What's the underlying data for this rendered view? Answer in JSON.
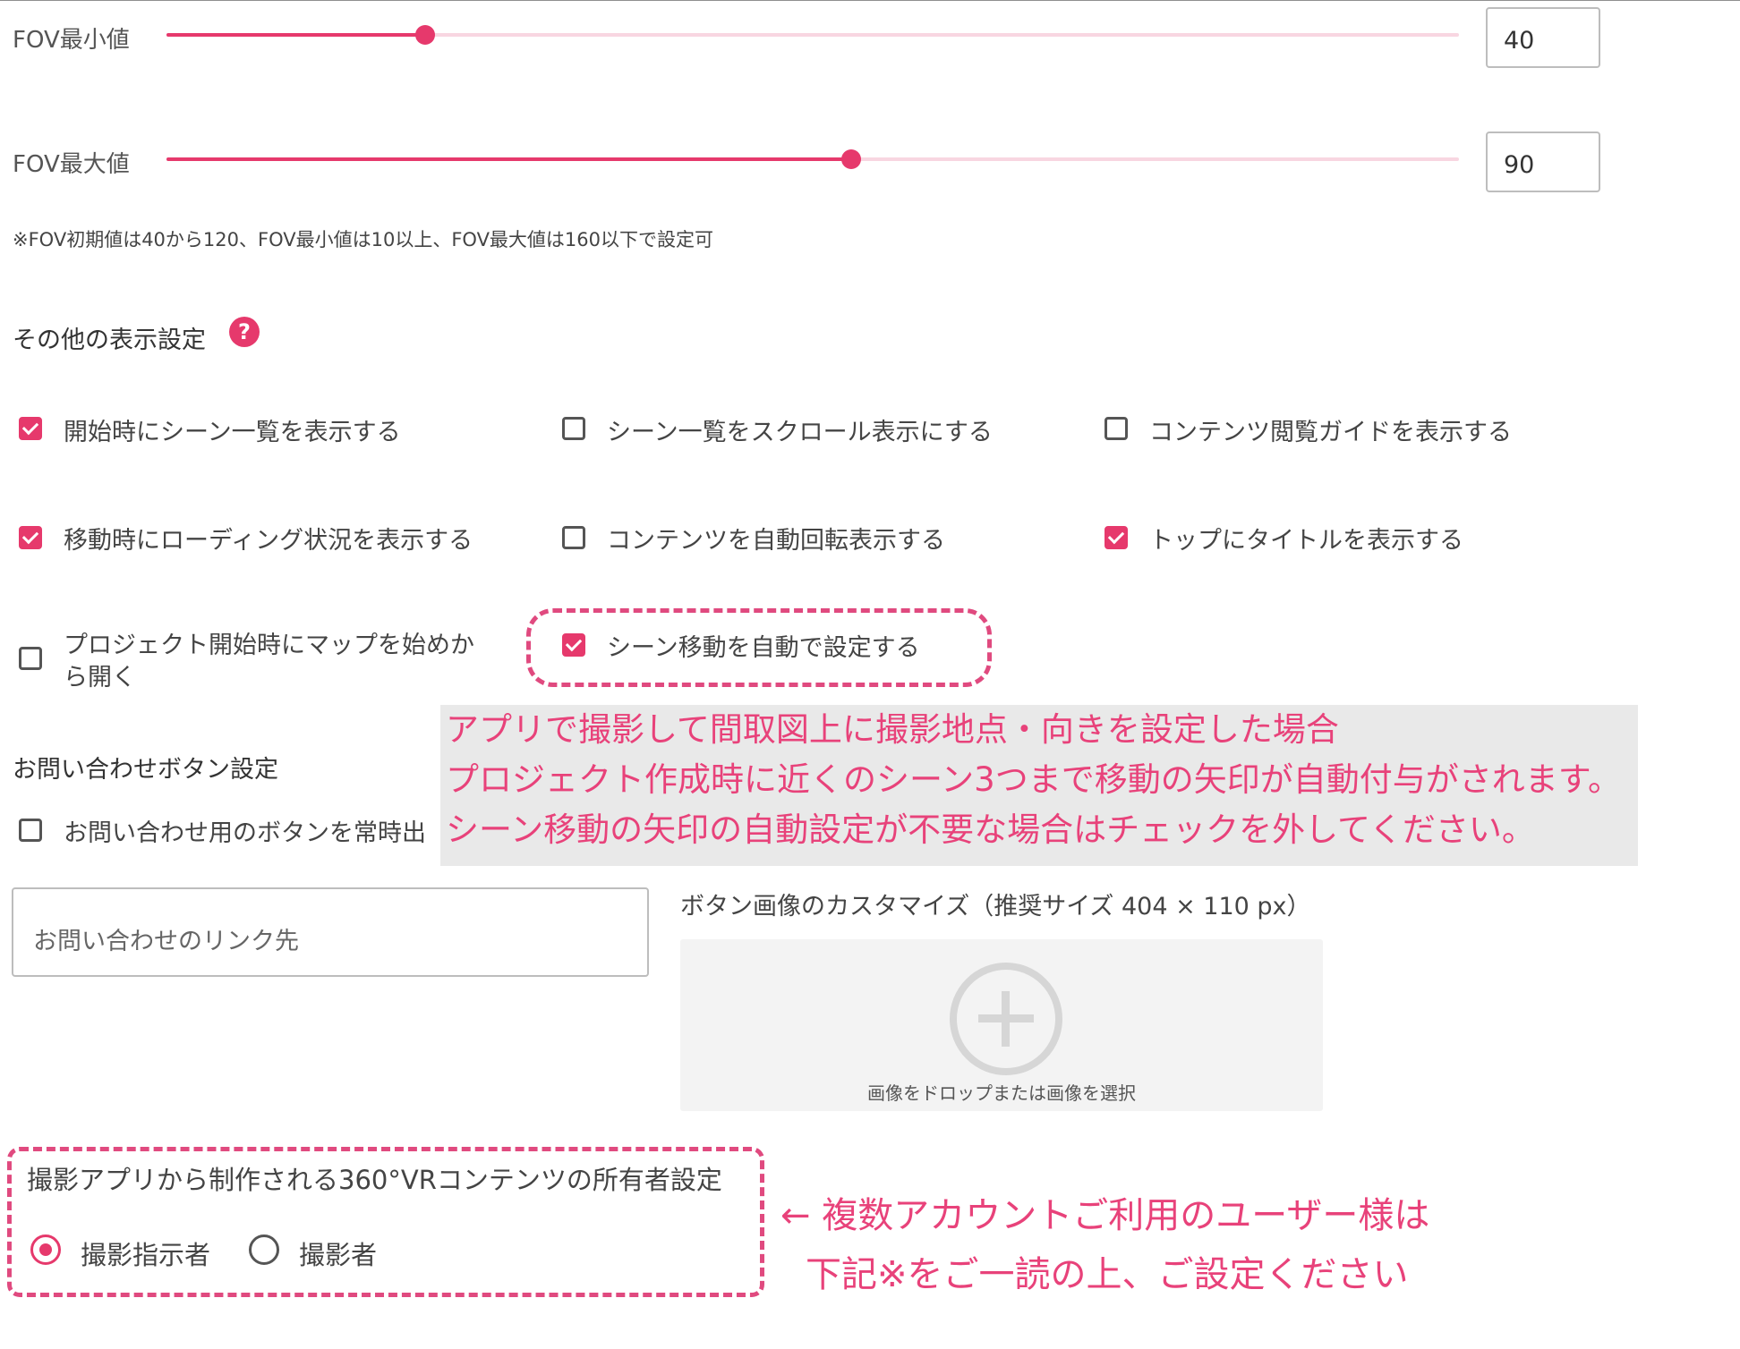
{
  "fov": {
    "min": {
      "label": "FOV最小値",
      "value": "40",
      "fraction": 0.2
    },
    "max": {
      "label": "FOV最大値",
      "value": "90",
      "fraction": 0.53
    },
    "note": "※FOV初期値は40から120、FOV最小値は10以上、FOV最大値は160以下で設定可"
  },
  "display_settings": {
    "heading": "その他の表示設定",
    "help_icon": "?",
    "options": [
      {
        "label": "開始時にシーン一覧を表示する",
        "checked": true
      },
      {
        "label": "シーン一覧をスクロール表示にする",
        "checked": false
      },
      {
        "label": "コンテンツ閲覧ガイドを表示する",
        "checked": false
      },
      {
        "label": "移動時にローディング状況を表示する",
        "checked": true
      },
      {
        "label": "コンテンツを自動回転表示する",
        "checked": false
      },
      {
        "label": "トップにタイトルを表示する",
        "checked": true
      },
      {
        "label_line1": "プロジェクト開始時にマップを始めか",
        "label_line2": "ら開く",
        "checked": false
      },
      {
        "label": "シーン移動を自動で設定する",
        "checked": true
      }
    ]
  },
  "callout": {
    "lines": [
      "アプリで撮影して間取図上に撮影地点・向きを設定した場合",
      "プロジェクト作成時に近くのシーン3つまで移動の矢印が自動付与がされます。",
      "シーン移動の矢印の自動設定が不要な場合はチェックを外してください。"
    ]
  },
  "contact": {
    "heading": "お問い合わせボタン設定",
    "always_show_label": "お問い合わせ用のボタンを常時出",
    "always_show_checked": false,
    "link_placeholder": "お問い合わせのリンク先",
    "image_heading": "ボタン画像のカスタマイズ（推奨サイズ 404 × 110 px）",
    "upload_text": "画像をドロップまたは画像を選択"
  },
  "owner": {
    "heading": "撮影アプリから制作される360°VRコンテンツの所有者設定",
    "options": [
      {
        "label": "撮影指示者",
        "selected": true
      },
      {
        "label": "撮影者",
        "selected": false
      }
    ],
    "annotation_line1": "← 複数アカウントご利用のユーザー様は",
    "annotation_line2": "下記※をご一読の上、ご設定ください"
  },
  "colors": {
    "accent": "#e6396c",
    "annotation": "#e8427a",
    "callout_bg": "#e9e9e9"
  }
}
